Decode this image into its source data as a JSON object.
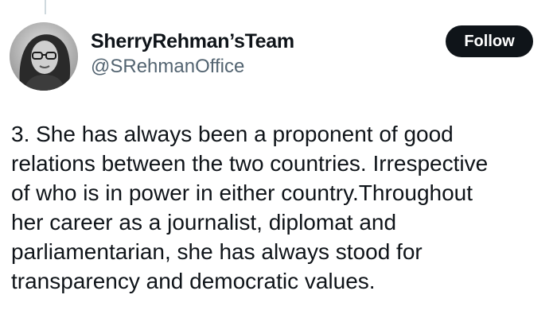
{
  "author": {
    "display_name": "SherryRehman’sTeam",
    "handle": "@SRehmanOffice",
    "avatar_icon": "profile-photo"
  },
  "actions": {
    "follow_label": "Follow"
  },
  "tweet": {
    "lines": [
      "3. She has always been a proponent of good",
      "relations between the two countries. Irrespective",
      "of who is in power in either country.Throughout",
      "her career as a journalist, diplomat and",
      "parliamentarian, she has always stood for",
      "transparency and democratic values."
    ]
  },
  "colors": {
    "text_primary": "#0f1419",
    "text_secondary": "#536471",
    "button_bg": "#0f1419",
    "button_text": "#ffffff"
  }
}
